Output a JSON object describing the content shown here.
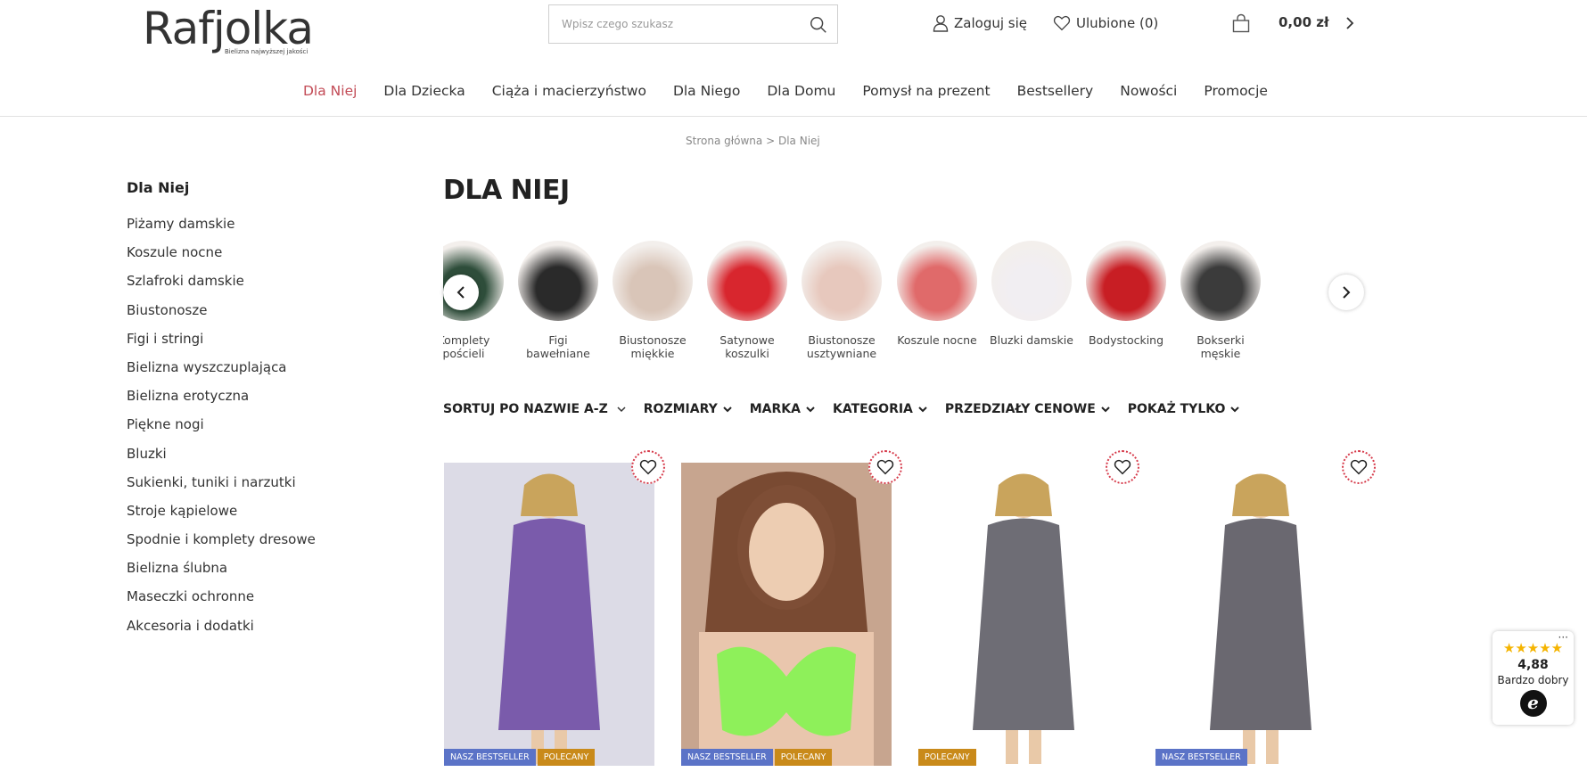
{
  "brand": {
    "logo_text": "Rafjolka",
    "tagline": "Bielizna najwyższej jakości",
    "accent_color": "#c2354a"
  },
  "header": {
    "search_placeholder": "Wpisz czego szukasz",
    "login_label": "Zaloguj się",
    "favorites_label": "Ulubione (0)",
    "cart_total": "0,00 zł"
  },
  "mainnav": {
    "items": [
      {
        "label": "Dla Niej",
        "active": true
      },
      {
        "label": "Dla Dziecka"
      },
      {
        "label": "Ciąża i macierzyństwo"
      },
      {
        "label": "Dla Niego"
      },
      {
        "label": "Dla Domu"
      },
      {
        "label": "Pomysł na prezent"
      },
      {
        "label": "Bestsellery"
      },
      {
        "label": "Nowości"
      },
      {
        "label": "Promocje"
      }
    ]
  },
  "breadcrumb": {
    "home": "Strona główna",
    "separator": ">",
    "current": "Dla Niej"
  },
  "sidebar": {
    "title": "Dla Niej",
    "items": [
      "Piżamy damskie",
      "Koszule nocne",
      "Szlafroki damskie",
      "Biustonosze",
      "Figi i stringi",
      "Bielizna wyszczuplająca",
      "Bielizna erotyczna",
      "Piękne nogi",
      "Bluzki",
      "Sukienki, tuniki i narzutki",
      "Stroje kąpielowe",
      "Spodnie i komplety dresowe",
      "Bielizna ślubna",
      "Maseczki ochronne",
      "Akcesoria i dodatki"
    ]
  },
  "page": {
    "title": "DLA NIEJ"
  },
  "categories": [
    {
      "label_1": "Komplety",
      "label_2": "pościeli",
      "color": "#2e4d3a"
    },
    {
      "label_1": "Figi",
      "label_2": "bawełniane",
      "color": "#2a2a2a"
    },
    {
      "label_1": "Biustonosze",
      "label_2": "miękkie",
      "color": "#d9c5b8"
    },
    {
      "label_1": "Satynowe",
      "label_2": "koszulki",
      "color": "#d8262e"
    },
    {
      "label_1": "Biustonosze",
      "label_2": "usztywniane",
      "color": "#e7c8bd"
    },
    {
      "label_1": "Koszule nocne",
      "label_2": "",
      "color": "#e06a6a"
    },
    {
      "label_1": "Bluzki damskie",
      "label_2": "",
      "color": "#f1eef2"
    },
    {
      "label_1": "Bodystocking",
      "label_2": "",
      "color": "#c81e24"
    },
    {
      "label_1": "Bokserki",
      "label_2": "męskie",
      "color": "#3b3b3b"
    }
  ],
  "filters": {
    "sort": "SORTUJ PO NAZWIE A-Z",
    "sizes": "ROZMIARY",
    "brand": "MARKA",
    "category": "KATEGORIA",
    "price": "PRZEDZIAŁY CENOWE",
    "show_only": "POKAŻ TYLKO"
  },
  "products": [
    {
      "badges": [
        "NASZ BESTSELLER",
        "POLECANY"
      ],
      "color": "#7a5bab"
    },
    {
      "badges": [
        "NASZ BESTSELLER",
        "POLECANY"
      ],
      "color": "#8ef05a"
    },
    {
      "badges": [
        "POLECANY"
      ],
      "color": "#6e6d75"
    },
    {
      "badges": [
        "NASZ BESTSELLER"
      ],
      "color": "#6a6870"
    }
  ],
  "trust_badge": {
    "stars": "★★★★★",
    "score": "4,88",
    "label": "Bardzo dobry",
    "logo_letter": "e",
    "more": "···"
  }
}
